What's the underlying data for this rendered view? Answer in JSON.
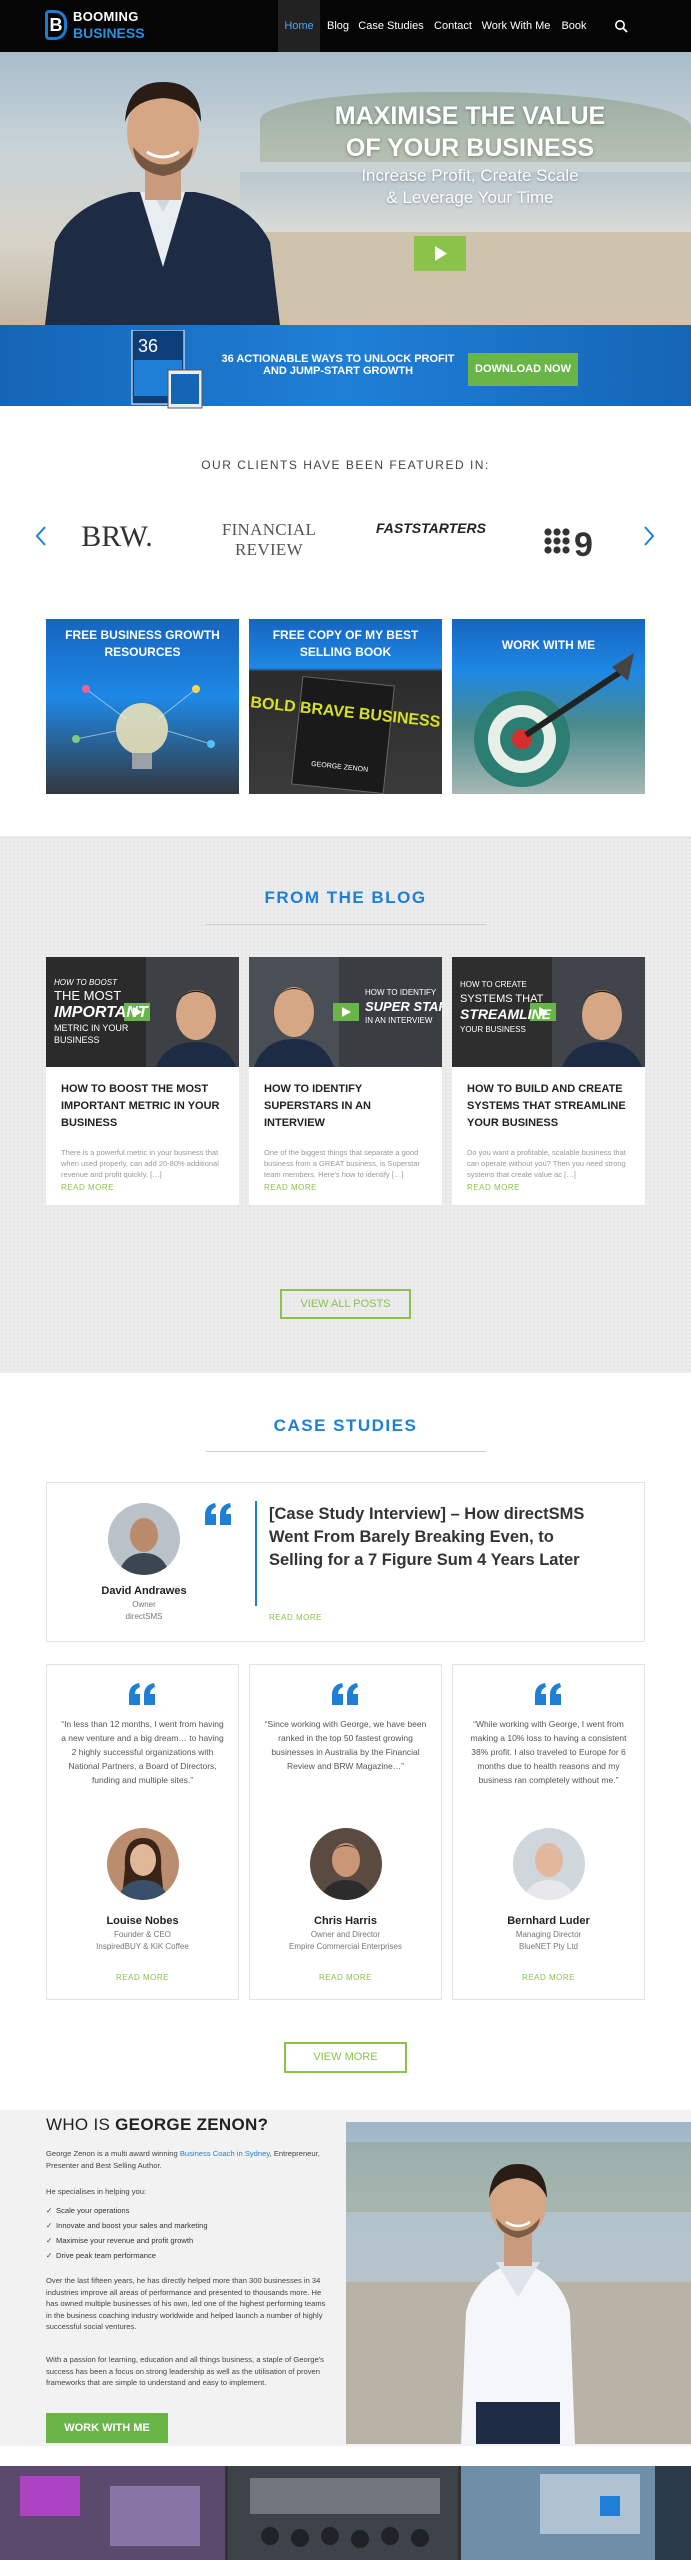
{
  "brand": {
    "line1": "BOOMING",
    "line2": "BUSINESS",
    "letter": "B"
  },
  "nav": {
    "items": [
      "Home",
      "Blog",
      "Case Studies",
      "Contact",
      "Work With Me",
      "Book"
    ]
  },
  "hero": {
    "title1": "MAXIMISE THE VALUE",
    "title2": "OF YOUR BUSINESS",
    "sub1": "Increase Profit, Create Scale",
    "sub2": "& Leverage Your Time"
  },
  "banner": {
    "ebook_number": "36",
    "text1": "36 ACTIONABLE WAYS TO UNLOCK PROFIT",
    "text2": "AND JUMP-START GROWTH",
    "button": "DOWNLOAD NOW"
  },
  "clients": {
    "heading": "OUR CLIENTS HAVE BEEN FEATURED IN:",
    "logos": [
      "BRW.",
      "FINANCIAL REVIEW",
      "FASTSTARTERS",
      "9"
    ]
  },
  "features": [
    {
      "label": "FREE BUSINESS GROWTH RESOURCES"
    },
    {
      "label": "FREE COPY OF MY BEST SELLING BOOK",
      "book_title": "BOLD BRAVE BUSINESS",
      "book_author": "GEORGE ZENON"
    },
    {
      "label": "WORK WITH ME"
    }
  ],
  "blog": {
    "heading": "FROM THE BLOG",
    "posts": [
      {
        "thumb_l1": "HOW TO BOOST",
        "thumb_l2": "THE MOST",
        "thumb_l3": "IMPORTANT",
        "thumb_l4": "METRIC IN YOUR",
        "thumb_l5": "BUSINESS",
        "title": "HOW TO BOOST THE MOST IMPORTANT METRIC IN YOUR BUSINESS",
        "excerpt": "There is a powerful metric in your business that when used properly, can add 20-80% additional revenue and profit quickly. […]",
        "more": "READ MORE"
      },
      {
        "thumb_l1": "HOW TO IDENTIFY",
        "thumb_l2": "SUPER STARS",
        "thumb_l3": "IN AN INTERVIEW",
        "title": "HOW TO IDENTIFY SUPERSTARS IN AN INTERVIEW",
        "excerpt": "One of the biggest things that separate a good business from a GREAT business, is Superstar team members. Here's how to identify […]",
        "more": "READ MORE"
      },
      {
        "thumb_l1": "HOW TO CREATE",
        "thumb_l2": "SYSTEMS THAT",
        "thumb_l3": "STREAMLINE",
        "thumb_l4": "YOUR BUSINESS",
        "title": "HOW TO BUILD AND CREATE SYSTEMS THAT STREAMLINE YOUR BUSINESS",
        "excerpt": "Do you want a profitable, scalable business that can operate without you? Then you need strong systems that create value ac […]",
        "more": "READ MORE"
      }
    ],
    "view_all": "VIEW ALL POSTS"
  },
  "cases": {
    "heading": "CASE STUDIES",
    "featured": {
      "name": "David Andrawes",
      "role": "Owner",
      "company": "directSMS",
      "title": "[Case Study Interview] – How directSMS Went From Barely Breaking Even, to Selling for a 7 Figure Sum 4 Years Later",
      "more": "READ MORE"
    },
    "testimonials": [
      {
        "quote": "“In less than 12 months, I went from having a new venture and a big dream… to having 2 highly successful organizations with National Partners, a Board of Directors, funding and multiple sites.”",
        "name": "Louise Nobes",
        "role": "Founder & CEO",
        "company": "InspiredBUY & KiK Coffee",
        "more": "READ MORE"
      },
      {
        "quote": "“Since working with George, we have been ranked in the top 50 fastest growing businesses in Australia by the Financial Review and BRW Magazine…”",
        "name": "Chris Harris",
        "role": "Owner and Director",
        "company": "Empire Commercial Enterprises",
        "more": "READ MORE"
      },
      {
        "quote": "“While working with George, I went from making a 10% loss to having a consistent 38% profit. I also traveled to Europe for 6 months due to health reasons and my business ran completely without me.”",
        "name": "Bernhard Luder",
        "role": "Managing Director",
        "company": "BlueNET Pty Ltd",
        "more": "READ MORE"
      }
    ],
    "view_more": "VIEW MORE"
  },
  "about": {
    "heading_plain": "WHO IS ",
    "heading_bold": "GEORGE ZENON?",
    "intro_pre": "George Zenon is a multi award winning ",
    "intro_link": "Business Coach in Sydney",
    "intro_post": ", Entrepreneur, Presenter and Best Selling Author.",
    "specialises": "He specialises in helping you:",
    "bullets": [
      "Scale your operations",
      "Innovate and boost your sales and marketing",
      "Maximise your revenue and profit growth",
      "Drive peak team performance"
    ],
    "para2": "Over the last fifteen years, he has directly helped more than 300 businesses in 34 industries improve all areas of performance and presented to thousands more. He has owned multiple businesses of his own, led one of the highest performing teams in the business coaching industry worldwide and helped launch a number of highly successful social ventures.",
    "para3": "With a passion for learning, education and all things business, a staple of George's success has been a focus on strong leadership as well as the utilisation of proven frameworks that are simple to understand and easy to implement.",
    "button": "WORK WITH ME"
  }
}
